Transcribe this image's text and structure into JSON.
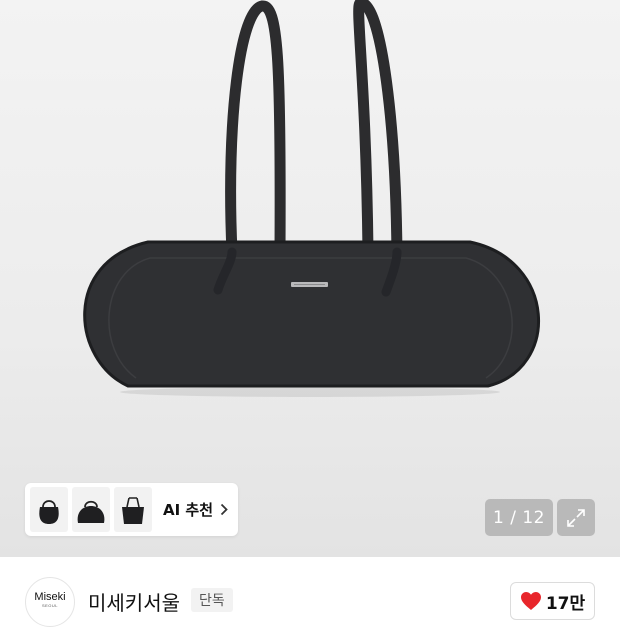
{
  "gallery": {
    "current": "1",
    "total": "12",
    "counter_text": "1 / 12",
    "expand_icon": "expand-arrows-icon"
  },
  "ai_recommend": {
    "label": "AI 추천",
    "thumbnails": [
      "bag-thumbnail-hobo",
      "bag-thumbnail-boston",
      "bag-thumbnail-tote"
    ]
  },
  "brand": {
    "logo_text": "Miseki",
    "logo_subtext": "SEOUL",
    "name": "미세키서울",
    "badge": "단독"
  },
  "like": {
    "icon": "heart-icon",
    "count": "17만",
    "color": "#e8262b"
  }
}
